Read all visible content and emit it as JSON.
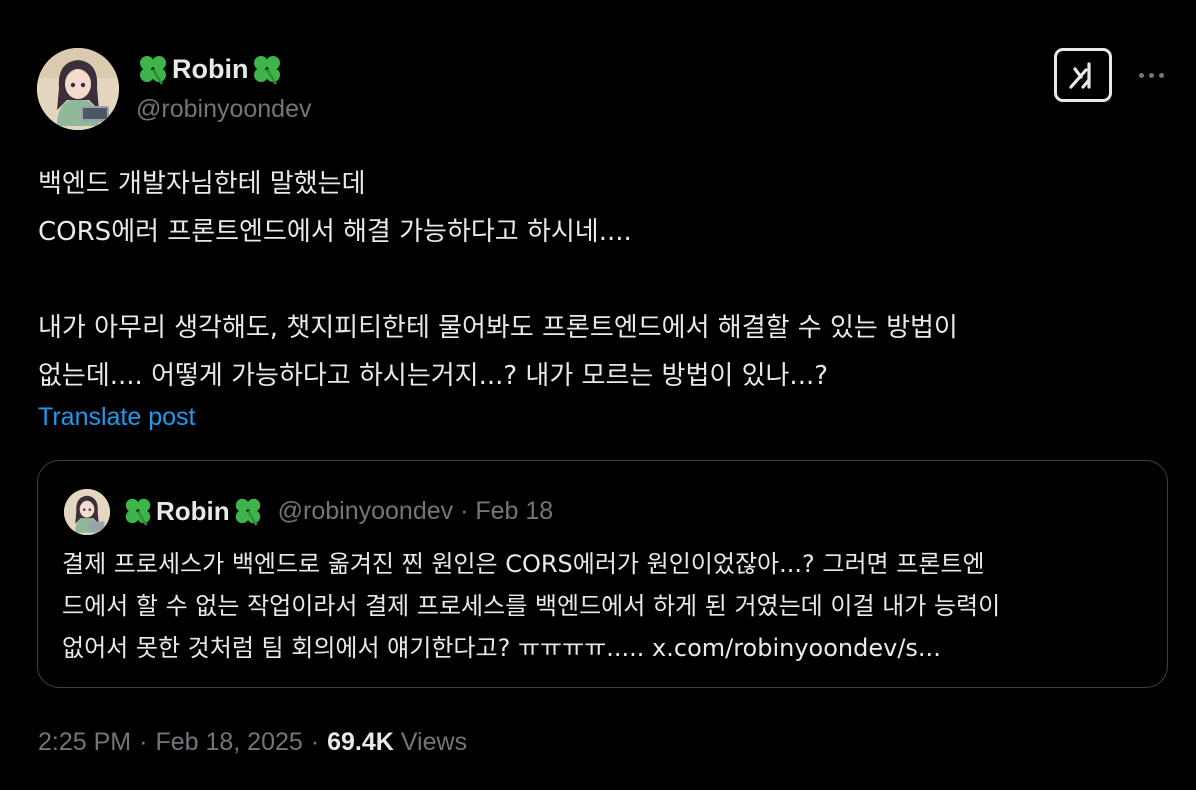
{
  "author": {
    "display_name": "Robin",
    "handle": "@robinyoondev",
    "avatar_icon": "anime-girl-laptop-avatar",
    "name_decoration_icon": "four-leaf-clover-icon"
  },
  "header_actions": {
    "grok_icon": "grok-icon",
    "more_icon": "more-dots-icon"
  },
  "post": {
    "lines": [
      "백엔드 개발자님한테 말했는데",
      "CORS에러 프론트엔드에서 해결 가능하다고 하시네....",
      "",
      "내가 아무리 생각해도, 챗지피티한테 물어봐도 프론트엔드에서 해결할 수 있는 방법이",
      "없는데.... 어떻게 가능하다고 하시는거지...? 내가 모르는 방법이 있나...?"
    ],
    "translate_label": "Translate post"
  },
  "quoted_post": {
    "display_name": "Robin",
    "meta": "@robinyoondev · Feb 18",
    "lines": [
      "결제 프로세스가 백엔드로 옮겨진 찐 원인은 CORS에러가 원인이었잖아...? 그러면 프론트엔",
      "드에서 할 수 없는 작업이라서 결제 프로세스를 백엔드에서 하게 된 거였는데 이걸 내가 능력이",
      "없어서 못한 것처럼 팀 회의에서 얘기한다고? ㅠㅠㅠㅠ..... x.com/robinyoondev/s..."
    ]
  },
  "footer": {
    "time": "2:25 PM",
    "date": "Feb 18, 2025",
    "views_count": "69.4K",
    "views_label": "Views",
    "separator": "·"
  },
  "colors": {
    "background": "#000000",
    "text_primary": "#e7e9ea",
    "text_secondary": "#71767b",
    "link": "#1d9bf0",
    "border": "#3e4144",
    "clover_green": "#3db54a"
  }
}
